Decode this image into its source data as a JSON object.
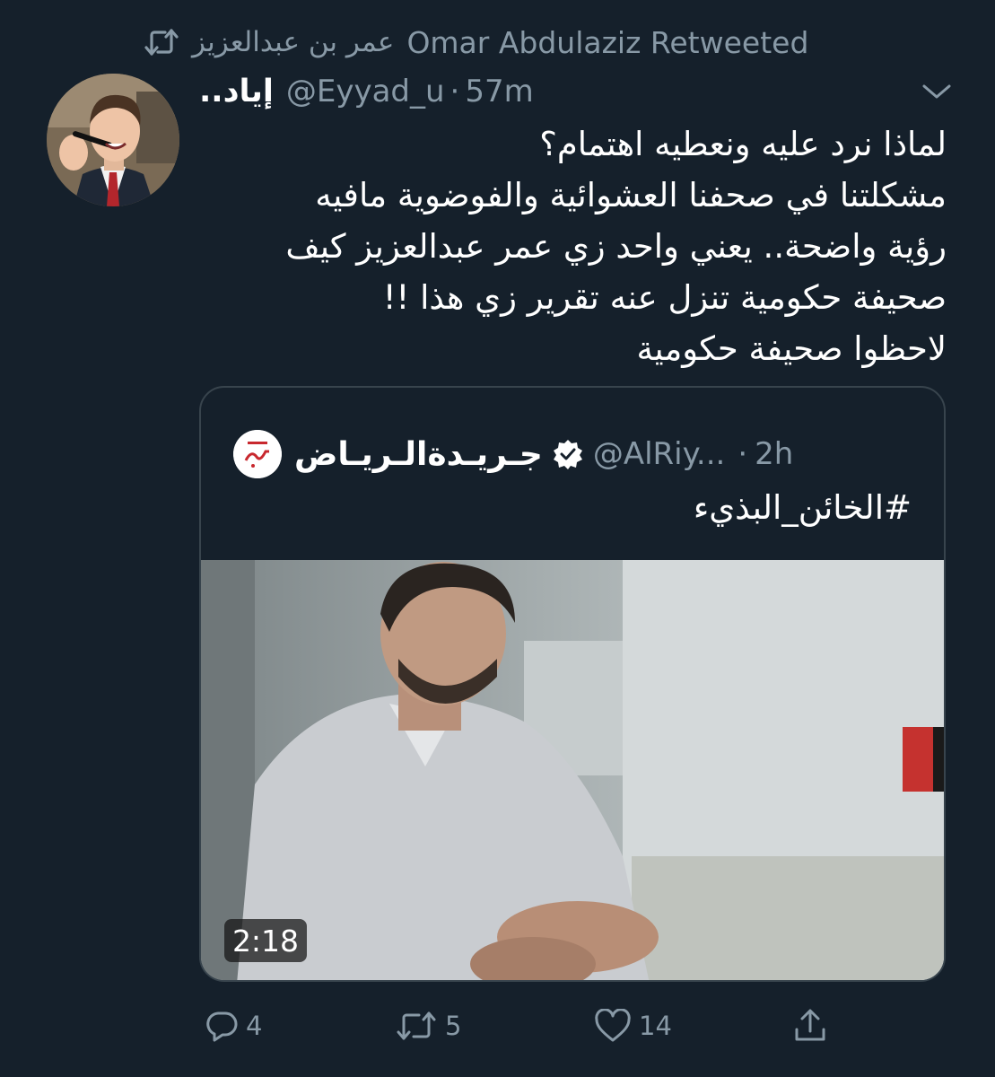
{
  "retweet_header": {
    "retweeter_name": "عمر بن عبدالعزيز",
    "label": "Omar Abdulaziz Retweeted",
    "icon": "retweet-icon"
  },
  "tweet": {
    "author_name": "إياد..",
    "handle": "@Eyyad_u",
    "separator": "·",
    "time": "57m",
    "menu_icon": "chevron-down-icon",
    "lines": [
      "لماذا نرد عليه ونعطيه اهتمام؟",
      "مشكلتنا في صحفنا العشوائية والفوضوية مافيه",
      "رؤية واضحة.. يعني واحد زي عمر عبدالعزيز كيف",
      "صحيفة حكومية تنزل عنه تقرير زي هذا !!",
      "لاحظوا صحيفة حكومية"
    ]
  },
  "quoted_tweet": {
    "name": "جـريـدةالـريـاض",
    "verified_icon": "verified-badge-icon",
    "handle": "@AlRiy...",
    "separator": "·",
    "time": "2h",
    "hashtag": "#الخائن_البذيء",
    "video_duration": "2:18"
  },
  "actions": {
    "reply": {
      "icon": "reply-icon",
      "count": "4"
    },
    "retweet": {
      "icon": "retweet-icon",
      "count": "5"
    },
    "like": {
      "icon": "heart-icon",
      "count": "14"
    },
    "share": {
      "icon": "share-icon"
    }
  },
  "colors": {
    "background": "#15202b",
    "secondary_text": "#8899a6",
    "border": "#38444d",
    "primary_text": "#ffffff"
  }
}
